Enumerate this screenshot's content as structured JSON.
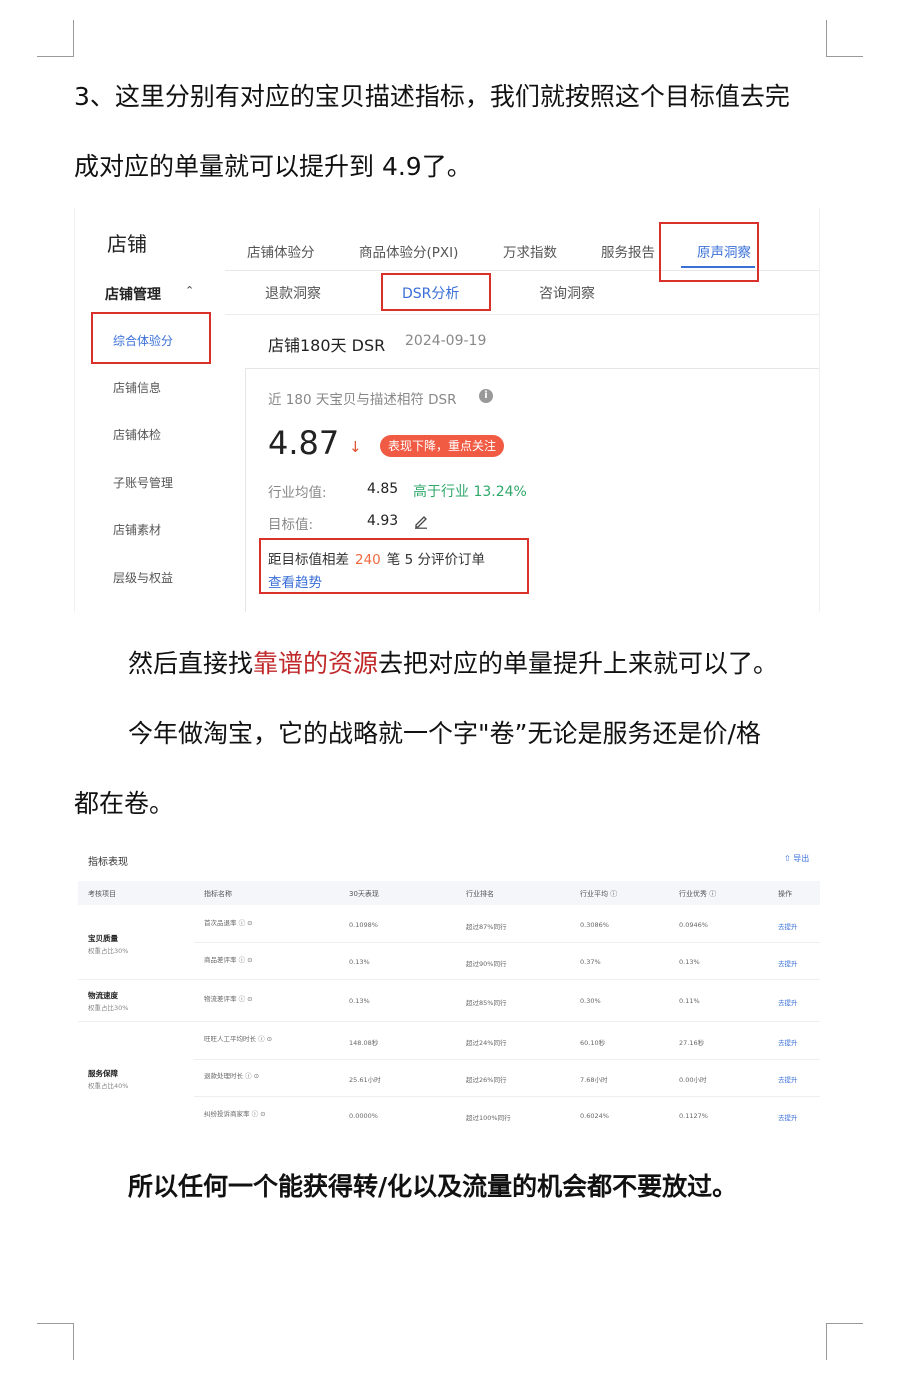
{
  "intro_line1": "3、这里分别有对应的宝贝描述指标，我们就按照这个目标值去完",
  "intro_line2": "成对应的单量就可以提升到 4.9了。",
  "shot1": {
    "shop": "店铺",
    "shop_mgmt": "店铺管理",
    "caret": "⌃",
    "sidebar": [
      "综合体验分",
      "店铺信息",
      "店铺体检",
      "子账号管理",
      "店铺素材",
      "层级与权益"
    ],
    "tabs": [
      "店铺体验分",
      "商品体验分(PXI)",
      "万求指数",
      "服务报告",
      "原声洞察"
    ],
    "subtabs": [
      "退款洞察",
      "DSR分析",
      "咨询洞察"
    ],
    "dsr_title": "店铺180天 DSR",
    "dsr_date": "2024-09-19",
    "near_label": "近 180 天宝贝与描述相符 DSR",
    "info_icon": "i",
    "score": "4.87",
    "down_arrow": "↓",
    "badge": "表现下降，重点关注",
    "industry_label": "行业均值:",
    "industry_value": "4.85",
    "industry_compare": "高于行业 13.24%",
    "target_label": "目标值:",
    "target_value": "4.93",
    "gap_prefix": "距目标值相差",
    "gap_num": "240",
    "gap_suffix": "笔 5 分评价订单",
    "trend_link": "查看趋势",
    "colors": {
      "accent": "#3a6fd8",
      "alert": "#f15b44",
      "positive": "#2fa86a",
      "highlight_box": "#d9302a"
    }
  },
  "para2_a": "然后直接找",
  "para2_hl": "靠谱的资源",
  "para2_b": "去把对应的单量提升上来就可以了。",
  "para3_line1": "今年做淘宝，它的战略就一个字\"卷”无论是服务还是价/格",
  "para3_line2": "都在卷。",
  "shot2": {
    "title": "指标表现",
    "export": "⇧ 导出",
    "headers": [
      "考核项目",
      "指标名称",
      "30天表现",
      "行业排名",
      "行业平均 ⓘ",
      "行业优秀 ⓘ",
      "操作"
    ],
    "groups": [
      {
        "name": "宝贝质量",
        "weight": "权重占比30%"
      },
      {
        "name": "物流速度",
        "weight": "权重占比30%"
      },
      {
        "name": "服务保障",
        "weight": "权重占比40%"
      }
    ],
    "rows": [
      [
        "首次品退率 ⓘ ⊙",
        "0.1098%",
        "超过87%同行",
        "0.3086%",
        "0.0946%",
        "去提升"
      ],
      [
        "商品差评率 ⓘ ⊙",
        "0.13%",
        "超过90%同行",
        "0.37%",
        "0.13%",
        "去提升"
      ],
      [
        "物流差评率 ⓘ ⊙",
        "0.13%",
        "超过85%同行",
        "0.30%",
        "0.11%",
        "去提升"
      ],
      [
        "旺旺人工平均时长 ⓘ ⊙",
        "148.08秒",
        "超过24%同行",
        "60.10秒",
        "27.16秒",
        "去提升"
      ],
      [
        "退款处理时长 ⓘ ⊙",
        "25.61小时",
        "超过26%同行",
        "7.68小时",
        "0.00小时",
        "去提升"
      ],
      [
        "纠纷投诉商家率 ⓘ ⊙",
        "0.0000%",
        "超过100%同行",
        "0.6024%",
        "0.1127%",
        "去提升"
      ]
    ]
  },
  "conclusion": "所以任何一个能获得转/化以及流量的机会都不要放过。"
}
